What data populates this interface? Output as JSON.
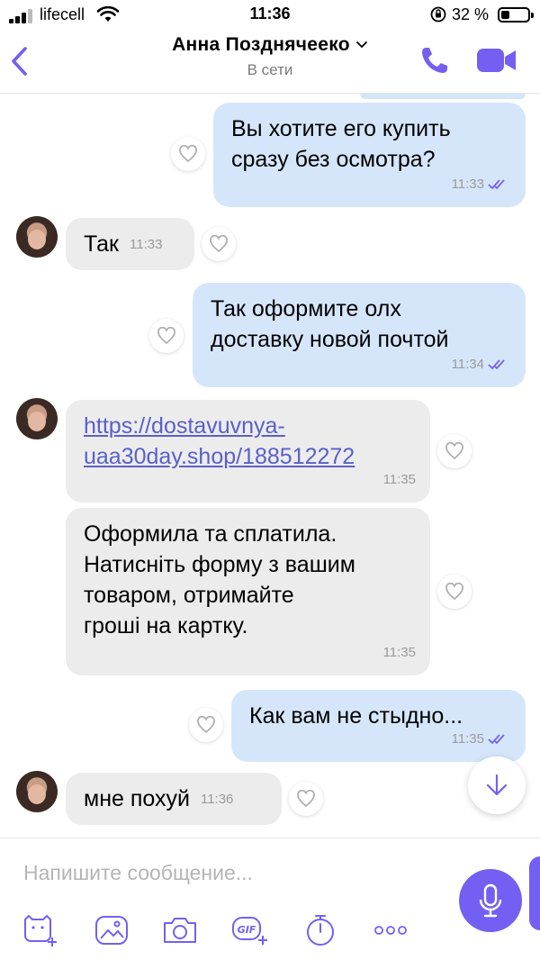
{
  "status_bar": {
    "carrier": "lifecell",
    "time": "11:36",
    "battery": "32 %",
    "battery_level": 0.32
  },
  "header": {
    "contact_name": "Анна Позднячеeко",
    "contact_status": "В сети"
  },
  "messages": [
    {
      "direction": "out",
      "text": "Вы хотите его купить\nсразу без осмотра?",
      "time": "11:33",
      "read": true
    },
    {
      "direction": "in",
      "text": "Так",
      "time": "11:33"
    },
    {
      "direction": "out",
      "text": "Так оформите олх\nдоставку новой почтой",
      "time": "11:34",
      "read": true
    },
    {
      "direction": "in",
      "text": "https://dostavuvnya-\nuaa30day.shop/188512272",
      "time": "11:35",
      "is_link": true
    },
    {
      "direction": "in",
      "text": "Оформила та сплатила.\nНатисніть форму з вашим\nтоваром, отримайте\nгроші на картку.",
      "time": "11:35"
    },
    {
      "direction": "out",
      "text": "Как вам не стыдно...",
      "time": "11:35",
      "read": true
    },
    {
      "direction": "in",
      "text": "мне похуй",
      "time": "11:36"
    }
  ],
  "composer": {
    "placeholder": "Напишите сообщение...",
    "value": "",
    "tools": [
      "sticker-icon",
      "gallery-icon",
      "camera-icon",
      "gif-icon",
      "timer-icon",
      "more-icon"
    ]
  },
  "colors": {
    "accent": "#7360f2",
    "outgoing_bubble": "#d5e6fb",
    "incoming_bubble": "#ececec",
    "link": "#5a60c9"
  }
}
